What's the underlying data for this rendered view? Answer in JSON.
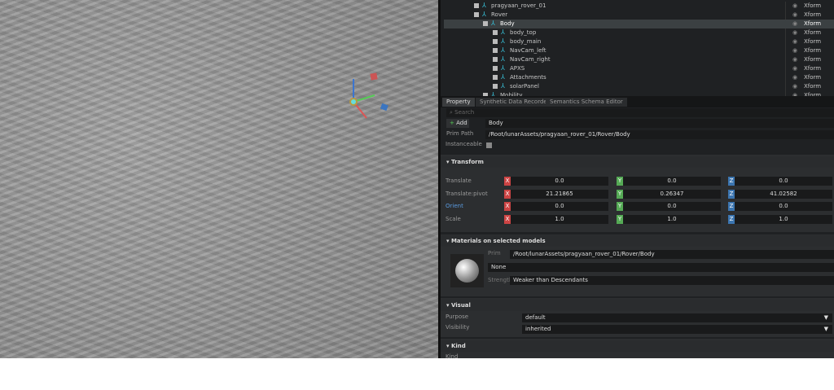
{
  "stage": {
    "rows": [
      {
        "label": "pragyaan_rover_01",
        "type": "Xform",
        "depth": 0
      },
      {
        "label": "Rover",
        "type": "Xform",
        "depth": 1
      },
      {
        "label": "Body",
        "type": "Xform",
        "depth": 2,
        "selected": true
      },
      {
        "label": "body_top",
        "type": "Xform",
        "depth": 3
      },
      {
        "label": "body_main",
        "type": "Xform",
        "depth": 3
      },
      {
        "label": "NavCam_left",
        "type": "Xform",
        "depth": 3
      },
      {
        "label": "NavCam_right",
        "type": "Xform",
        "depth": 3
      },
      {
        "label": "APXS",
        "type": "Xform",
        "depth": 3
      },
      {
        "label": "Attachments",
        "type": "Xform",
        "depth": 3
      },
      {
        "label": "solarPanel",
        "type": "Xform",
        "depth": 3
      },
      {
        "label": "Mobility",
        "type": "Xform",
        "depth": 2
      }
    ]
  },
  "tabs": [
    "Property",
    "Synthetic Data Recorder",
    "Semantics Schema Editor"
  ],
  "property": {
    "search_placeholder": "Search",
    "add_label": "Add",
    "name": "Body",
    "prim_path_label": "Prim Path",
    "prim_path": "/Root/lunarAssets/pragyaan_rover_01/Rover/Body",
    "instanceable_label": "Instanceable",
    "transform": {
      "title": "Transform",
      "rows": [
        {
          "label": "Translate",
          "x": "0.0",
          "y": "0.0",
          "z": "0.0"
        },
        {
          "label": "Translate:pivot",
          "x": "21.21865",
          "y": "0.26347",
          "z": "41.02582"
        },
        {
          "label": "Orient",
          "x": "0.0",
          "y": "0.0",
          "z": "0.0"
        },
        {
          "label": "Scale",
          "x": "1.0",
          "y": "1.0",
          "z": "1.0"
        }
      ],
      "axes": [
        "X",
        "Y",
        "Z"
      ]
    },
    "materials": {
      "title": "Materials on selected models",
      "prim_label": "Prim",
      "prim": "/Root/lunarAssets/pragyaan_rover_01/Rover/Body",
      "material": "None",
      "strength_label": "Strength",
      "strength": "Weaker than Descendants"
    },
    "visual": {
      "title": "Visual",
      "purpose_label": "Purpose",
      "purpose": "default",
      "visibility_label": "Visibility",
      "visibility": "inherited"
    },
    "kind": {
      "title": "Kind",
      "kind_label": "Kind"
    }
  }
}
